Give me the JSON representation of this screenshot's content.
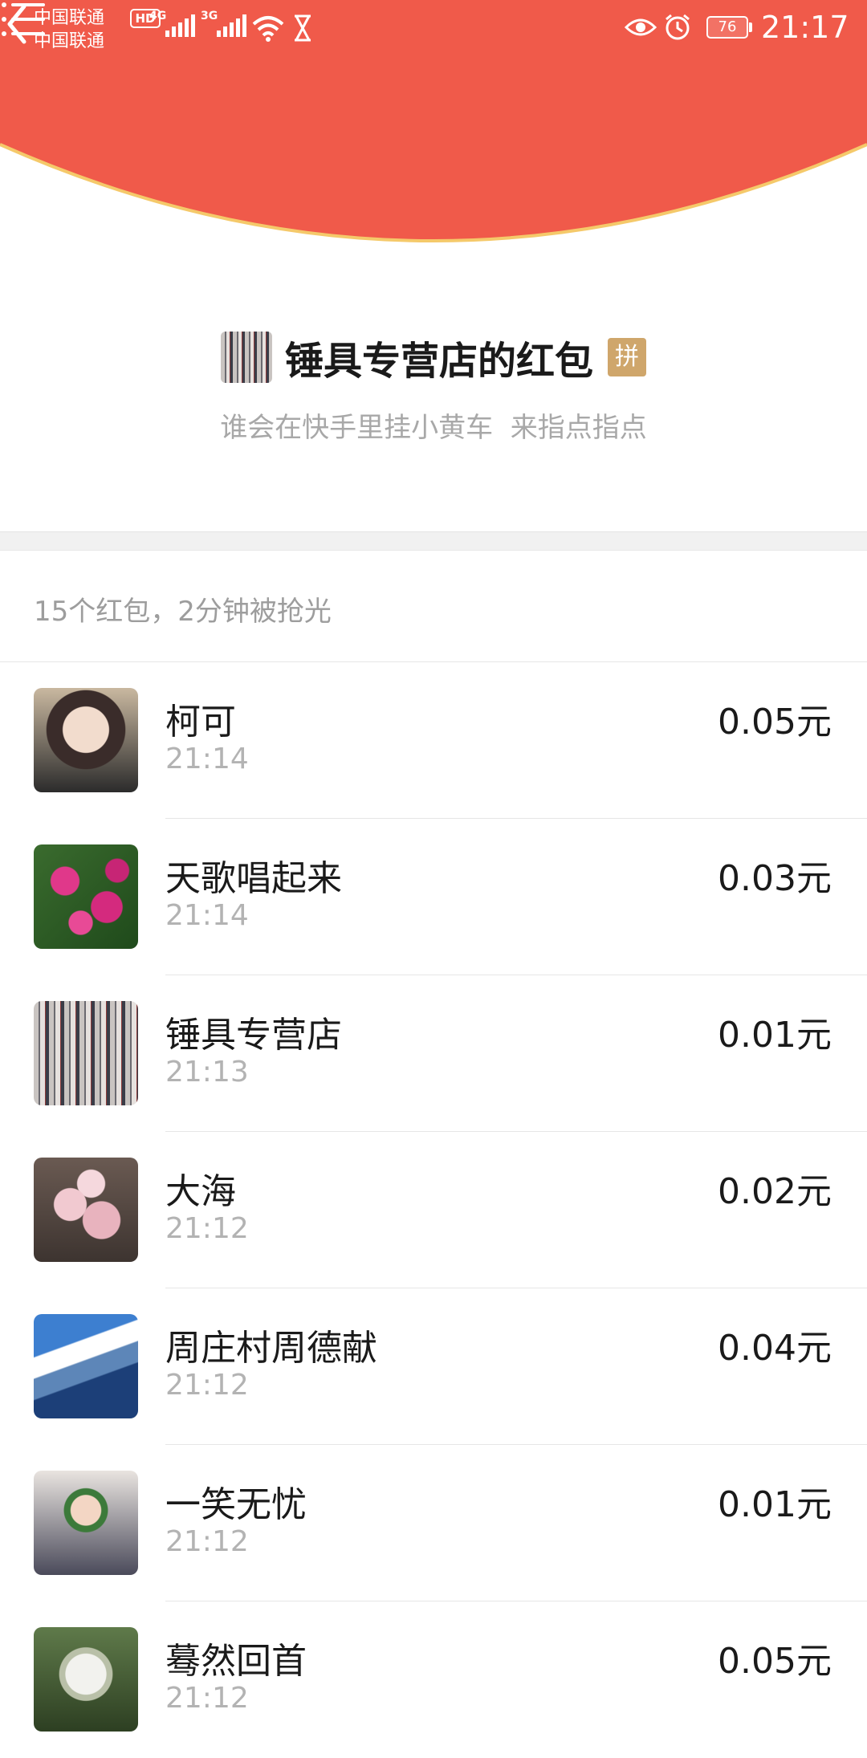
{
  "status_bar": {
    "carrier_1": "中国联通",
    "carrier_2": "中国联通",
    "hd_badge": "HD",
    "network_1": "4G",
    "network_2": "3G",
    "battery": "76",
    "time": "21:17"
  },
  "header": {
    "color": "#f05a4a",
    "border_color": "#f5c96a"
  },
  "title": {
    "text": "锤具专营店的红包",
    "badge": "拼",
    "subtitle": "谁会在快手里挂小黄车  来指点指点"
  },
  "summary": "15个红包，2分钟被抢光",
  "entries": [
    {
      "name": "柯可",
      "time": "21:14",
      "amount": "0.05元"
    },
    {
      "name": "天歌唱起来",
      "time": "21:14",
      "amount": "0.03元"
    },
    {
      "name": "锤具专营店",
      "time": "21:13",
      "amount": "0.01元"
    },
    {
      "name": "大海",
      "time": "21:12",
      "amount": "0.02元"
    },
    {
      "name": "周庄村周德献",
      "time": "21:12",
      "amount": "0.04元"
    },
    {
      "name": "一笑无忧",
      "time": "21:12",
      "amount": "0.01元"
    },
    {
      "name": "蓦然回首",
      "time": "21:12",
      "amount": "0.05元"
    }
  ]
}
